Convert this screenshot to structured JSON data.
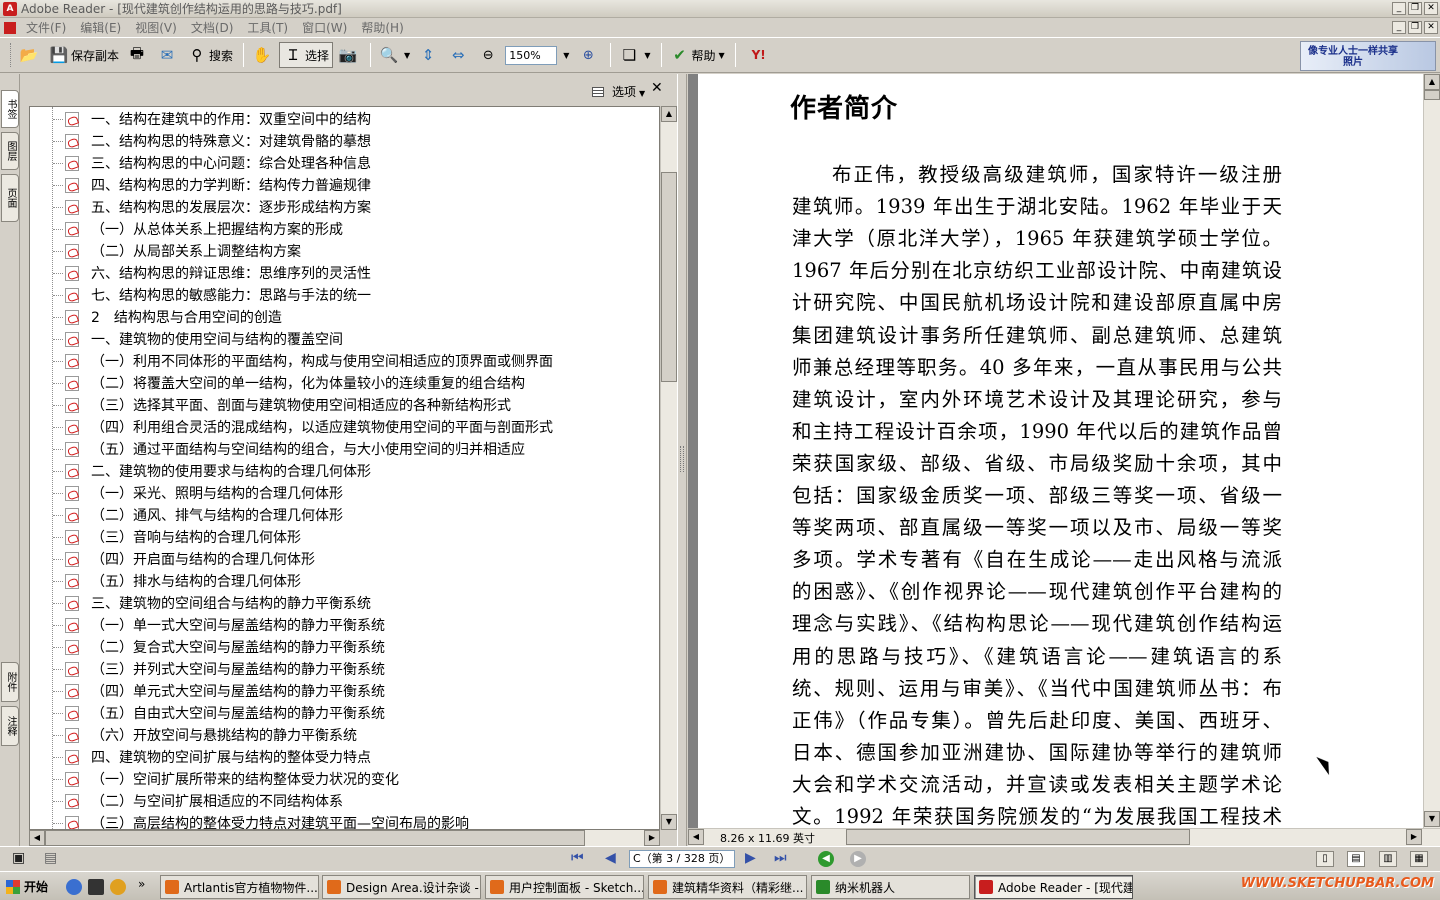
{
  "window": {
    "title": "Adobe Reader - [现代建筑创作结构运用的思路与技巧.pdf]"
  },
  "menu": [
    "文件(F)",
    "编辑(E)",
    "视图(V)",
    "文档(D)",
    "工具(T)",
    "窗口(W)",
    "帮助(H)"
  ],
  "toolbar": {
    "save_copy": "保存副本",
    "search": "搜索",
    "select": "选择",
    "zoom_value": "150%",
    "help": "帮助",
    "ad_text_1": "像专业人士一样共享",
    "ad_text_2": "照片"
  },
  "left_tabs": {
    "top": [
      "书签",
      "图层",
      "页面"
    ],
    "bottom": [
      "附件",
      "注释"
    ]
  },
  "bookmarks_panel": {
    "options_label": "选项",
    "items": [
      "一、结构在建筑中的作用：双重空间中的结构",
      "二、结构构思的特殊意义：对建筑骨骼的摹想",
      "三、结构构思的中心问题：综合处理各种信息",
      "四、结构构思的力学判断：结构传力普遍规律",
      "五、结构构思的发展层次：逐步形成结构方案",
      "（一）从总体关系上把握结构方案的形成",
      "（二）从局部关系上调整结构方案",
      "六、结构构思的辩证思维：思维序列的灵活性",
      "七、结构构思的敏感能力：思路与手法的统一",
      "2　结构构思与合用空间的创造",
      "一、建筑物的使用空间与结构的覆盖空间",
      "（一）利用不同体形的平面结构，构成与使用空间相适应的顶界面或侧界面",
      "（二）将覆盖大空间的单一结构，化为体量较小的连续重复的组合结构",
      "（三）选择其平面、剖面与建筑物使用空间相适应的各种新结构形式",
      "（四）利用组合灵活的混成结构，以适应建筑物使用空间的平面与剖面形式",
      "（五）通过平面结构与空间结构的组合，与大小使用空间的归并相适应",
      "二、建筑物的使用要求与结构的合理几何体形",
      "（一）采光、照明与结构的合理几何体形",
      "（二）通风、排气与结构的合理几何体形",
      "（三）音响与结构的合理几何体形",
      "（四）开启面与结构的合理几何体形",
      "（五）排水与结构的合理几何体形",
      "三、建筑物的空间组合与结构的静力平衡系统",
      "（一）单一式大空间与屋盖结构的静力平衡系统",
      "（二）复合式大空间与屋盖结构的静力平衡系统",
      "（三）并列式大空间与屋盖结构的静力平衡系统",
      "（四）单元式大空间与屋盖结构的静力平衡系统",
      "（五）自由式大空间与屋盖结构的静力平衡系统",
      "（六）开放空间与悬挑结构的静力平衡系统",
      "四、建筑物的空间扩展与结构的整体受力特点",
      "（一）空间扩展所带来的结构整体受力状况的变化",
      "（二）与空间扩展相适应的不同结构体系",
      "（三）高层结构的整体受力特点对建筑平面—空间布局的影响"
    ]
  },
  "document": {
    "heading": "作者简介",
    "lines": [
      "布正伟，教授级高级建筑师，国家特许一级注册",
      "建筑师。1939 年出生于湖北安陆。1962 年毕业于天",
      "津大学（原北洋大学），1965 年获建筑学硕士学位。",
      "1967 年后分别在北京纺织工业部设计院、中南建筑设",
      "计研究院、中国民航机场设计院和建设部原直属中房",
      "集团建筑设计事务所任建筑师、副总建筑师、总建筑",
      "师兼总经理等职务。40 多年来，一直从事民用与公共",
      "建筑设计，室内外环境艺术设计及其理论研究，参与",
      "和主持工程设计百余项，1990 年代以后的建筑作品曾",
      "荣获国家级、部级、省级、市局级奖励十余项，其中",
      "包括：国家级金质奖一项、部级三等奖一项、省级一",
      "等奖两项、部直属级一等奖一项以及市、局级一等奖",
      "多项。学术专著有《自在生成论——走出风格与流派",
      "的困惑》、《创作视界论——现代建筑创作平台建构的",
      "理念与实践》、《结构构思论——现代建筑创作结构运",
      "用的思路与技巧》、《建筑语言论——建筑语言的系",
      "统、规则、运用与审美》、《当代中国建筑师丛书：布",
      "正伟》（作品专集）。曾先后赴印度、美国、西班牙、",
      "日本、德国参加亚洲建协、国际建协等举行的建筑师",
      "大会和学术交流活动，并宣读或发表相关主题学术论",
      "文。1992 年荣获国务院颁发的“为发展我国工程技术"
    ],
    "page_size": "8.26 x 11.69 英寸"
  },
  "statusbar": {
    "page_indicator": "C（第 3 / 328 页）"
  },
  "taskbar": {
    "start": "开始",
    "tasks": [
      "Artlantis官方植物物件...",
      "Design Area.设计杂谈 - ...",
      "用户控制面板 - Sketch...",
      "建筑精华资料（精彩继...",
      "纳米机器人",
      "Adobe Reader - [现代建..."
    ],
    "watermark": "WWW.SKETCHUPBAR.COM"
  }
}
